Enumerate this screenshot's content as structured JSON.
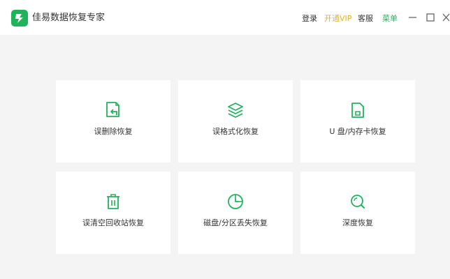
{
  "app": {
    "title": "佳易数据恢复专家",
    "logo_icon": "brand-logo-icon",
    "brand_color": "#1fb45a"
  },
  "header": {
    "login_label": "登录",
    "vip_label": "开通VIP",
    "service_label": "客服",
    "menu_label": "菜单",
    "vip_color": "#e9b21f",
    "menu_color": "#1fb45a"
  },
  "window_controls": [
    "minimize-icon",
    "maximize-icon",
    "close-icon"
  ],
  "cards": [
    {
      "label": "误删除恢复",
      "icon": "deleted-file-recovery-icon"
    },
    {
      "label": "误格式化恢复",
      "icon": "layers-icon"
    },
    {
      "label": "U 盘/内存卡恢复",
      "icon": "sd-card-icon"
    },
    {
      "label": "误清空回收站恢复",
      "icon": "trash-icon"
    },
    {
      "label": "磁盘/分区丢失恢复",
      "icon": "partition-pie-icon"
    },
    {
      "label": "深度恢复",
      "icon": "deep-search-icon"
    }
  ],
  "accent_color": "#1fb45a"
}
